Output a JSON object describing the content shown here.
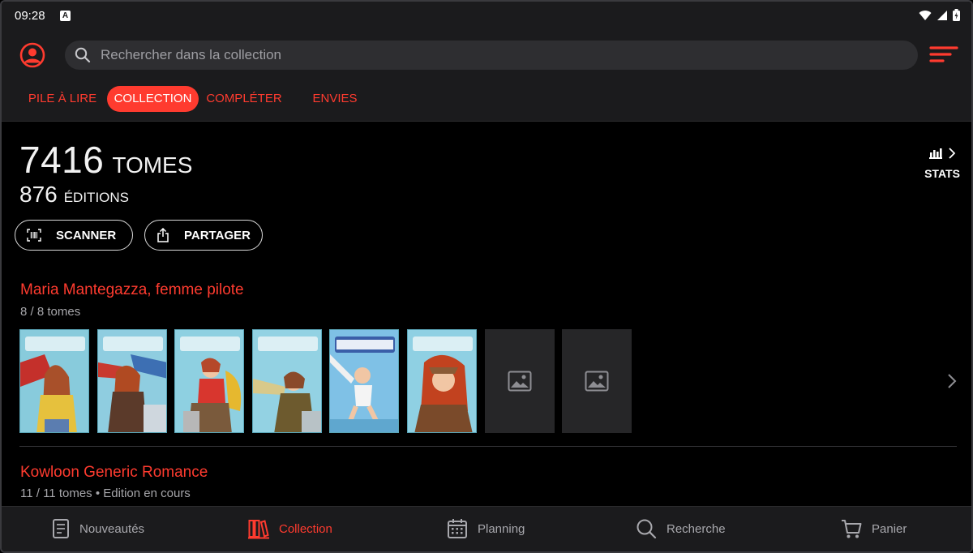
{
  "status": {
    "time": "09:28",
    "notif": "A"
  },
  "search": {
    "placeholder": "Rechercher dans la collection"
  },
  "tabs": [
    {
      "label": "PILE À LIRE",
      "active": false
    },
    {
      "label": "COLLECTION",
      "active": true
    },
    {
      "label": "COMPLÉTER",
      "active": false
    },
    {
      "label": "ENVIES",
      "active": false
    }
  ],
  "summary": {
    "tomes_count": "7416",
    "tomes_label": "TOMES",
    "editions_count": "876",
    "editions_label": "ÉDITIONS",
    "stats_label": "STATS"
  },
  "actions": {
    "scanner": "SCANNER",
    "share": "PARTAGER"
  },
  "series": [
    {
      "title": "Maria Mantegazza, femme pilote",
      "subtitle": "8 / 8 tomes",
      "covers": [
        "filled",
        "filled",
        "filled",
        "filled",
        "filled",
        "filled",
        "empty",
        "empty"
      ]
    },
    {
      "title": "Kowloon Generic Romance",
      "subtitle": "11 / 11 tomes • Edition en cours"
    }
  ],
  "bottom_nav": [
    {
      "label": "Nouveautés",
      "icon": "newspaper-icon",
      "active": false
    },
    {
      "label": "Collection",
      "icon": "books-icon",
      "active": true
    },
    {
      "label": "Planning",
      "icon": "calendar-icon",
      "active": false
    },
    {
      "label": "Recherche",
      "icon": "search-icon",
      "active": false
    },
    {
      "label": "Panier",
      "icon": "cart-icon",
      "active": false
    }
  ],
  "colors": {
    "accent": "#ff3b2f",
    "surface": "#1b1b1d",
    "background": "#000000"
  }
}
